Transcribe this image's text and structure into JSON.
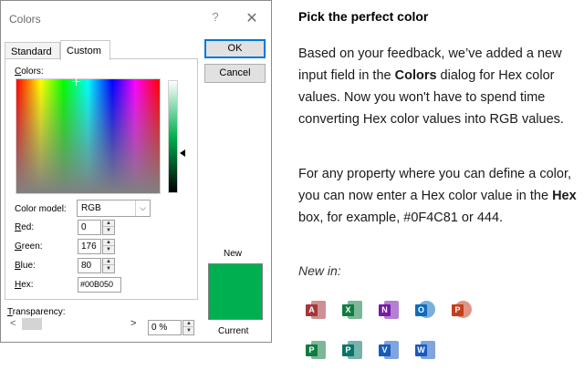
{
  "dialog": {
    "title": "Colors",
    "help_glyph": "?",
    "close_glyph": "✕",
    "tabs": [
      {
        "label": "Standard",
        "selected": false
      },
      {
        "label": "Custom",
        "selected": true
      }
    ],
    "colors_label": {
      "accel": "C",
      "rest": "olors:"
    },
    "color_model": {
      "label_accel": "",
      "label": "Color model:",
      "value": "RGB",
      "arrow": "⌵"
    },
    "red": {
      "accel": "R",
      "rest": "ed:",
      "value": "0"
    },
    "green": {
      "accel": "G",
      "rest": "reen:",
      "value": "176"
    },
    "blue": {
      "accel": "B",
      "rest": "lue:",
      "value": "80"
    },
    "hex": {
      "accel": "H",
      "rest": "ex:",
      "value": "#00B050"
    },
    "transparency": {
      "accel": "T",
      "rest": "ransparency:",
      "value": "0 %",
      "left_glyph": "<",
      "right_glyph": ">"
    },
    "spin_up": "▲",
    "spin_down": "▼",
    "ok_label": "OK",
    "cancel_label": "Cancel",
    "new_label": "New",
    "current_label": "Current",
    "new_color": "#00B050"
  },
  "article": {
    "heading": "Pick the perfect color",
    "p1": {
      "a": "Based on your feedback, we’ve added a new input field in the ",
      "b": "Colors",
      "c": " dialog for Hex color values. Now you won't have to spend time converting Hex color values into RGB values."
    },
    "p2": {
      "a": "For any property where you can define a color, you can now enter a Hex color value in the ",
      "b": "Hex",
      "c": " box, for example, #0F4C81 or 444."
    },
    "new_in": "New in:",
    "apps": [
      {
        "icon": "access-icon",
        "letter": "A",
        "color": "#a4373a"
      },
      {
        "icon": "excel-icon",
        "letter": "X",
        "color": "#107c41"
      },
      {
        "icon": "onenote-icon",
        "letter": "N",
        "color": "#7719aa"
      },
      {
        "icon": "outlook-icon",
        "letter": "O",
        "color": "#0f6cbd"
      },
      {
        "icon": "powerpoint-icon",
        "letter": "P",
        "color": "#c43e1c"
      },
      {
        "icon": "project-icon",
        "letter": "P",
        "color": "#107c41"
      },
      {
        "icon": "publisher-icon",
        "letter": "P",
        "color": "#077568"
      },
      {
        "icon": "visio-icon",
        "letter": "V",
        "color": "#185abd"
      },
      {
        "icon": "word-icon",
        "letter": "W",
        "color": "#185abd"
      }
    ]
  }
}
